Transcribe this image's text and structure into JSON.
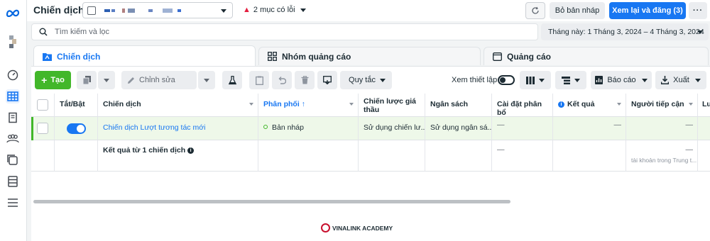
{
  "header": {
    "title": "Chiến dịch",
    "errors_label": "2 mục có lỗi",
    "discard_label": "Bỏ bản nháp",
    "publish_label": "Xem lại và đăng (3)",
    "more_label": "···"
  },
  "search": {
    "placeholder": "Tìm kiếm và lọc"
  },
  "date_range": "Tháng này: 1 Tháng 3, 2024 – 4 Tháng 3, 2024",
  "tabs": [
    {
      "label": "Chiến dịch",
      "active": true
    },
    {
      "label": "Nhóm quảng cáo",
      "active": false
    },
    {
      "label": "Quảng cáo",
      "active": false
    }
  ],
  "toolbar": {
    "create_label": "Tạo",
    "edit_label": "Chỉnh sửa",
    "rules_label": "Quy tắc",
    "view_setup_label": "Xem thiết lập",
    "report_label": "Báo cáo",
    "export_label": "Xuất"
  },
  "table": {
    "columns": [
      "Tắt/Bật",
      "Chiến dịch",
      "Phân phối ↑",
      "Chiến lược giá thầu",
      "Ngân sách",
      "Cài đặt phân bổ",
      "Kết quả",
      "Người tiếp cận",
      "Lư"
    ],
    "rows": [
      {
        "name": "Chiến dịch Lượt tương tác mới",
        "delivery": "Bản nháp",
        "bid_strategy": "Sử dụng chiến lư...",
        "budget": "Sử dụng ngân sá...",
        "attribution": "—",
        "results": "—",
        "reach": "—",
        "on": true
      }
    ],
    "summary": {
      "label": "Kết quả từ 1 chiến dịch",
      "attribution": "—",
      "reach": "—",
      "reach_note": "tài khoản trong Trung t..."
    }
  },
  "watermark": "VINALINK ACADEMY",
  "colors": {
    "primary": "#1877f2",
    "create_green": "#42b72a",
    "draft_row_bg": "#eef8e9",
    "error_red": "#e41e3f"
  }
}
